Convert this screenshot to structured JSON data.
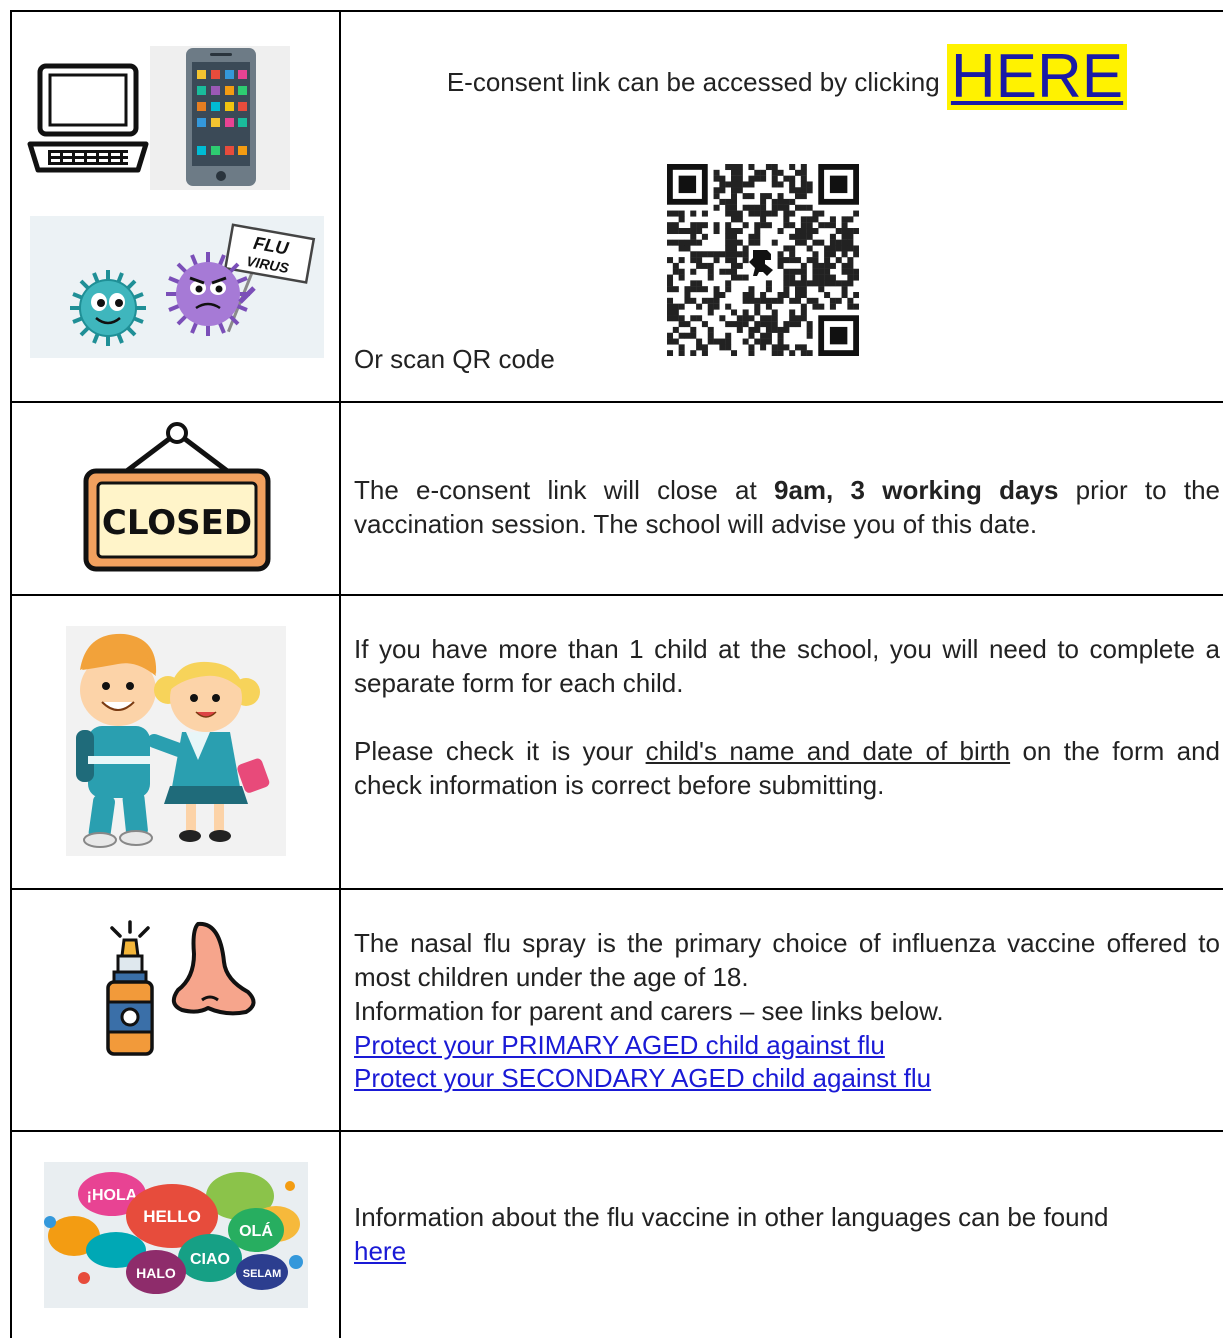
{
  "rows": [
    {
      "id": "econsent",
      "line1_prefix": "E-consent link can be accessed by clicking",
      "link_label": "HERE",
      "scan_text": "Or scan QR code",
      "icons": [
        "laptop-icon",
        "smartphone-icon",
        "flu-virus-illustration",
        "qr-code"
      ],
      "virus_sign_text": "FLU VIRUS"
    },
    {
      "id": "closing",
      "text_pre": "The e-consent link will close at ",
      "text_bold": "9am, 3 working days",
      "text_post": " prior to the vaccination session. The school will advise you of this date.",
      "sign_text": "CLOSED",
      "icon": "closed-sign-icon"
    },
    {
      "id": "multiple-children",
      "para1": "If you have more than 1 child at the school, you will need to complete a separate form for each child.",
      "para2_pre": "Please check it is your ",
      "para2_underlined": "child's name and date of birth",
      "para2_post": " on the form and check information is correct before submitting.",
      "icon": "children-illustration"
    },
    {
      "id": "nasal-spray",
      "para1": "The nasal flu spray is the primary choice of influenza vaccine offered to most children under the age of 18.",
      "para2": "Information for parent and carers – see links below.",
      "link_primary": "Protect your PRIMARY AGED child against flu",
      "link_secondary": "Protect your SECONDARY AGED child against flu",
      "icon": "nasal-spray-icon"
    },
    {
      "id": "languages",
      "text": "Information about the flu vaccine in other languages can be found",
      "link_label": "here",
      "bubble_words": [
        "¡HOLA",
        "HELLO",
        "OLÁ",
        "CIAO",
        "HALO",
        "SELAM"
      ],
      "icon": "languages-illustration"
    }
  ],
  "colors": {
    "highlight": "#fff200",
    "link": "#1a1ad6",
    "border": "#000000"
  }
}
